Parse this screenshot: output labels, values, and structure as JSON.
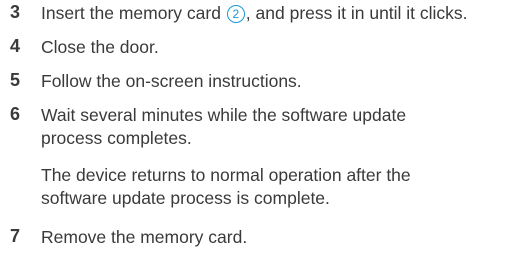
{
  "steps": [
    {
      "num": "3",
      "text_before": "Insert the memory card ",
      "marker": "2",
      "text_after": ", and press it in until it clicks."
    },
    {
      "num": "4",
      "text": "Close the door."
    },
    {
      "num": "5",
      "text": "Follow the on-screen instructions."
    },
    {
      "num": "6",
      "line1": "Wait several minutes while the software update",
      "line2": "process completes."
    },
    {
      "num": "7",
      "text": "Remove the memory card."
    }
  ],
  "note": {
    "line1": "The device returns to normal operation after the",
    "line2": "software update process is complete."
  },
  "colors": {
    "text": "#3a3a3a",
    "accent": "#1a9bd7"
  }
}
